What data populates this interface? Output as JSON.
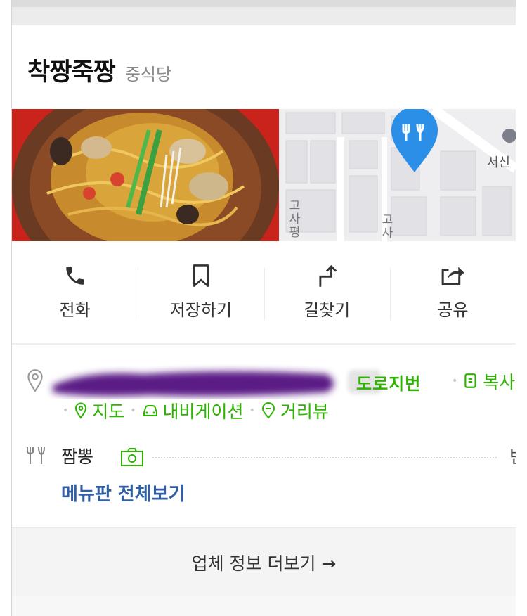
{
  "place": {
    "name": "착짱죽짱",
    "category": "중식당"
  },
  "map": {
    "place_label": "서신",
    "road_label_1": "고사평",
    "road_label_2": "고사"
  },
  "actions": [
    {
      "label": "전화",
      "icon": "phone-icon"
    },
    {
      "label": "저장하기",
      "icon": "bookmark-icon"
    },
    {
      "label": "길찾기",
      "icon": "directions-icon"
    },
    {
      "label": "공유",
      "icon": "share-icon"
    }
  ],
  "address": {
    "road_address_tail": "도로지번",
    "copy_label": "복사"
  },
  "links": {
    "map": "지도",
    "navigation": "내비게이션",
    "street_view": "거리뷰"
  },
  "menu": {
    "item_name": "짬뽕",
    "price_text": "변",
    "view_all": "메뉴판 전체보기"
  },
  "footer": {
    "more_info": "업체 정보 더보기 →"
  },
  "colors": {
    "accent_green": "#2db400",
    "link_blue": "#2f5fa6",
    "pin_blue": "#2b8fe8",
    "redaction_purple": "#5b1e86"
  }
}
